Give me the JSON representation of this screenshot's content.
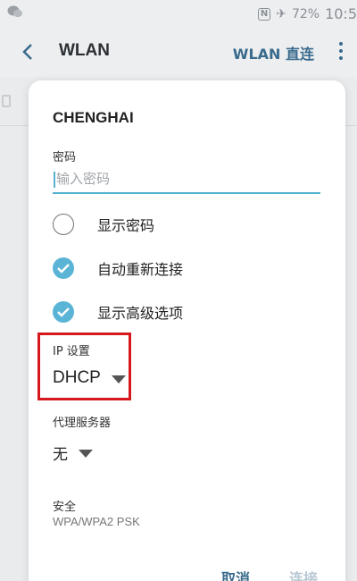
{
  "status_bar": {
    "left_icon": "wechat-icon",
    "nfc_label": "N",
    "airplane_icon": "airplane-icon",
    "battery": "72%",
    "time": "10:5"
  },
  "app_bar": {
    "title": "WLAN",
    "direct_label": "WLAN 直连"
  },
  "dialog": {
    "ssid": "CHENGHAI",
    "password_label": "密码",
    "password_placeholder": "输入密码",
    "options": [
      {
        "label": "显示密码",
        "checked": false
      },
      {
        "label": "自动重新连接",
        "checked": true
      },
      {
        "label": "显示高级选项",
        "checked": true
      }
    ],
    "ip_settings_label": "IP 设置",
    "ip_settings_value": "DHCP",
    "proxy_label": "代理服务器",
    "proxy_value": "无",
    "security_label": "安全",
    "security_value": "WPA/WPA2 PSK",
    "cancel_label": "取消",
    "connect_label": "连接"
  },
  "colors": {
    "accent": "#5ab4d6",
    "highlight_box": "#d6181e",
    "action_text": "#3a6a8c"
  }
}
